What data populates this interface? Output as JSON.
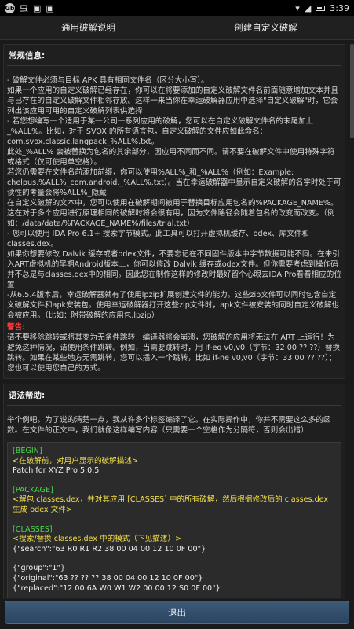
{
  "statusbar": {
    "left_a": "Gb",
    "left_b": "虫",
    "time": "3:39"
  },
  "tabs": [
    {
      "label": "通用破解说明"
    },
    {
      "label": "创建自定义破解"
    }
  ],
  "general": {
    "title": "常规信息:",
    "p1": "- 破解文件必须与目标 APK 具有相同文件名（区分大小写）。",
    "p2": "如果一个应用的自定义破解已经存在，你可以在将要添加的自定义破解文件名前面随意增加文本并且与已存在的自定义破解文件相邻存放。这样一来当你在幸运破解器应用中选择\"自定义破解\"时，它会列出该应用可用的自定义破解列表供选择",
    "p3": "- 若您想编写一个适用于某一公司一系列应用的破解，您可以在自定义破解文件名的末尾加上_%ALL%。比如，对于 SVOX 的所有语言包，自定义破解的文件应如此命名：com.svox.classic.langpack_%ALL%.txt。",
    "p4": "此处_%ALL% 会被替换为包名的其余部分，因应用不同而不同。请不要在破解文件中使用特殊字符或格式（仅可使用单空格）。",
    "p5": "若您仍需要在文件名前添加前缀，你可以使用%ALL%_和_%ALL%（例如：Example: chelpus.%ALL%_com.android._%ALL%.txt）。当在幸运破解器中显示自定义破解的名字时处于可读性的考量会将%ALL%_隐藏",
    "p6": "在自定义破解的文本中，您可以使用在破解期间被用于替换目标应用包名的%PACKAGE_NAME%。这在对于多个应用进行原理相同的破解时将会很有用，因为文件路径会随着包名的改变而改变。（例如：/data/data/%PACKAGE_NAME%/files/trial.txt）",
    "p7": "- 您可以使用 IDA Pro 6.1+ 搜索字节模式。此工具可以打开虚拟机缓存、odex、库文件和 classes.dex。",
    "p8": "如果你想要修改 Dalvik 缓存或者odex文件，不要忘记在不同固件版本中字节数据可能不同。在未引入ART虚拟机的早期Android版本上，你可以修改 Dalvik 缓存或odex文件。但你需要考虑到操作码并不总是与classes.dex中的相同。因此您在制作这样的修改时最好留个心眼去IDA Pro看看相应的位置",
    "p9": "-从6.5.4版本后，幸运破解器就有了使用lpzip扩展创建文件的能力。这些zip文件可以同时包含自定义破解文件和apk安装包。使用幸运破解器打开这些zip文件时，apk文件被安装的同时自定义破解也会被应用。（比如：附带破解的应用包.lpzip）",
    "warn": "警告:",
    "p10": "请不要移除跳转或将其变为无条件跳转！编译器将会崩溃，您破解的应用将无法在 ART 上运行！为避免这种情况，请使用条件跳转。例如，当需要跳转时，用 if-eq v0,v0（字节：32 00 ?? ??）替换跳转。如果在某些地方无需跳转，您可以插入一个跳转，比如 if-ne v0,v0（字节：33 00 ?? ??）；您也可以使用您自己的方式。"
  },
  "syntax": {
    "title": "语法帮助:",
    "intro": "举个例吧。为了说的清楚一点，我从许多个标签编译了它。在实际操作中，你并不需要这么多的函数。在文件的正文中，我们就像这样编写内容（只需要一个空格作为分隔符，否则会出错）",
    "begin_tag": "[BEGIN]",
    "begin_note": "<在破解前，对用户显示的破解描述>",
    "begin_value": "Patch for XYZ Pro 5.0.5",
    "package_tag": "[PACKAGE]",
    "package_note": "<解包 classes.dex，并对其应用 [CLASSES] 中的所有破解，然后根据修改后的 classes.dex 生成 odex 文件>",
    "classes_tag": "[CLASSES]",
    "classes_note": "<搜索/替换 classes.dex 中的模式（下见描述）>",
    "line1": "{\"search\":\"63 R0 R1 R2 38 00 04 00 12 10 0F 00\"}",
    "line2": "{\"group\":\"1\"}",
    "line3": "{\"original\":\"63 ?? ?? ?? 38 00 04 00 12 10 0F 00\"}",
    "line4": "{\"replaced\":\"12 00 6A W0 W1 W2 00 00 12 S0 0F 00\"}"
  },
  "exit_label": "退出"
}
